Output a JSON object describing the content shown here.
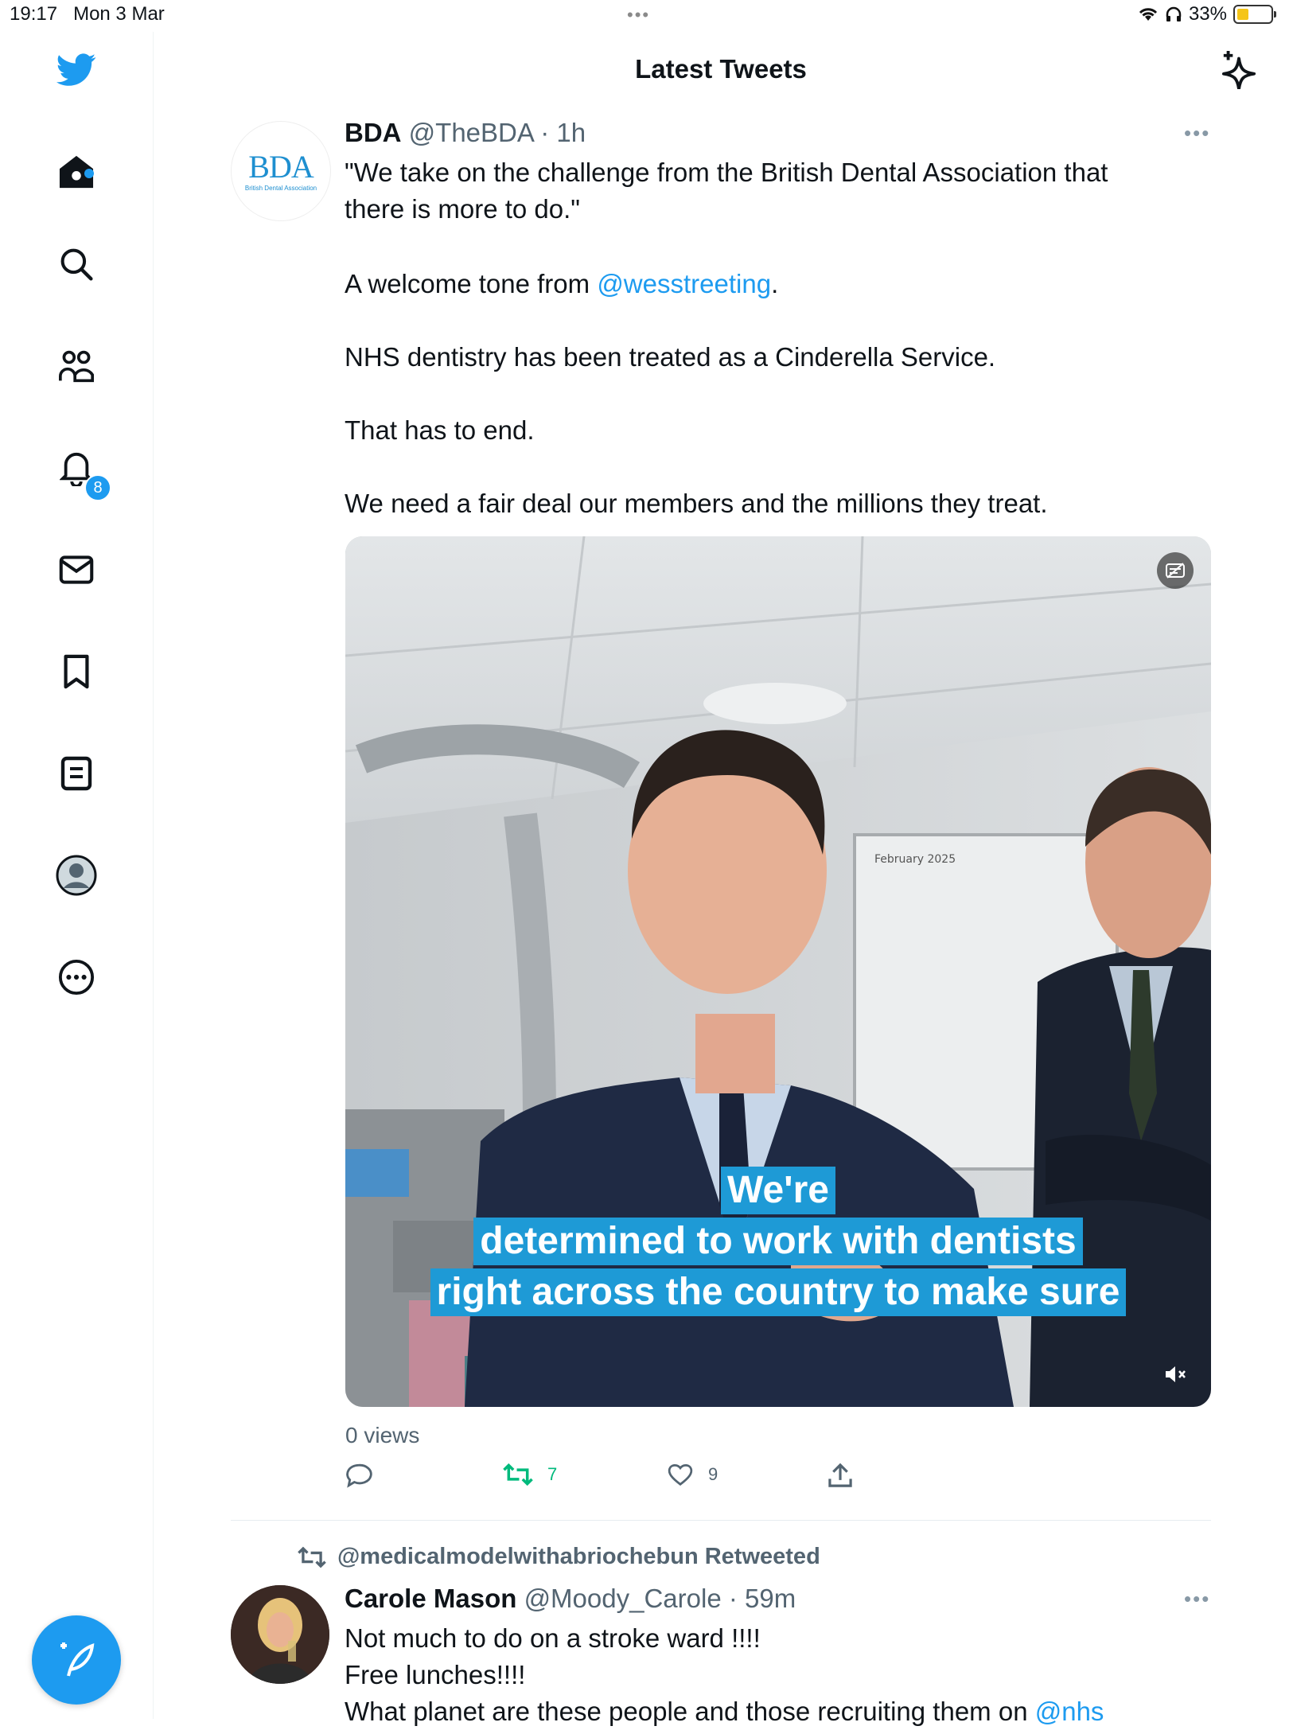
{
  "status_bar": {
    "time": "19:17",
    "date": "Mon 3 Mar",
    "battery": "33%"
  },
  "header": {
    "title": "Latest Tweets"
  },
  "sidebar": {
    "notifications_count": "8"
  },
  "tweets": [
    {
      "name": "BDA",
      "handle": "@TheBDA",
      "time": "1h",
      "avatar_text": "BDA",
      "avatar_subtext": "British Dental Association",
      "text_lines": [
        "\"We take on the challenge from the British Dental Association that",
        "there is more to do.\""
      ],
      "para2_prefix": "A welcome tone from ",
      "para2_mention": "@wesstreeting",
      "para2_suffix": ".",
      "para3": "NHS dentistry has been treated as a Cinderella Service.",
      "para4": "That has to end.",
      "para5": "We need a fair deal our members and the millions they treat.",
      "media": {
        "caption_lines": [
          "We're",
          "determined to work with dentists",
          "right across the country to make sure"
        ],
        "whiteboard_text": "February 2025"
      },
      "views": "0 views",
      "retweets": "7",
      "likes": "9"
    },
    {
      "retweeted_by": "@medicalmodelwithabriochebun Retweeted",
      "name": "Carole Mason",
      "handle": "@Moody_Carole",
      "time": "59m",
      "text_lines": [
        "Not much to do on a stroke ward !!!!",
        "Free lunches!!!!"
      ],
      "text_line3_prefix": "What planet are these people and those recruiting them on ",
      "text_line3_mention": "@nhs"
    }
  ],
  "colors": {
    "brand": "#1d9bf0",
    "retweet_green": "#00ba7c",
    "text_secondary": "#536471",
    "caption_bg": "#1e9ad6"
  }
}
